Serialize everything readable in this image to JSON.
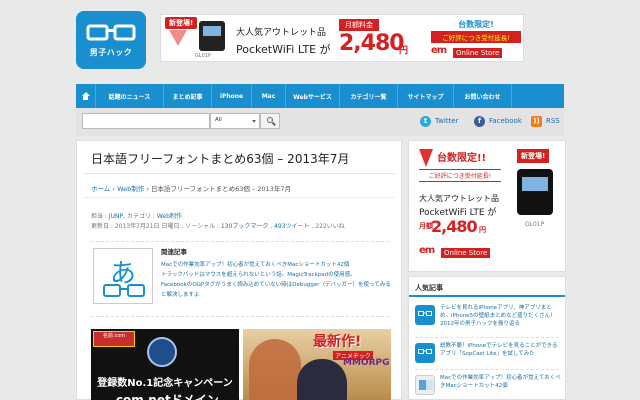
{
  "header": {
    "logo_text": "男子ハック",
    "banner": {
      "new_badge": "新登場!",
      "device_name": "GL01P",
      "line1": "大人気アウトレット品",
      "line2": "PocketWiFi LTE が",
      "fee_label": "月額料金",
      "price": "2,480",
      "yen": "円",
      "limited": "台数限定!",
      "extend": "ご好評につき受付延長!",
      "brand": "em",
      "store": "Online Store"
    }
  },
  "nav": {
    "items": [
      "話題のニュース",
      "まとめ記事",
      "iPhone",
      "Mac",
      "Webサービス",
      "カテゴリ一覧",
      "サイトマップ",
      "お問い合わせ"
    ]
  },
  "search": {
    "placeholder": "",
    "select_value": "All"
  },
  "social": {
    "twitter": "Twitter",
    "facebook": "Facebook",
    "rss": "RSS"
  },
  "article": {
    "title": "日本語フリーフォントまとめ63個 – 2013年7月",
    "breadcrumb": {
      "home": "ホーム",
      "sep": "›",
      "category": "Web制作",
      "current": "日本語フリーフォントまとめ63個 – 2013年7月"
    },
    "meta1": {
      "author_label": "担当 :",
      "author": "JUNP",
      "cat_label": ", カテゴリ :",
      "category": "Web制作"
    },
    "meta2": {
      "updated": "更新日 : 2013年7月21日 日曜日 , ソーシャル :",
      "bookmarks": "130ブックマーク",
      "tweets": "493ツイート",
      "likes": ", 222いいね"
    },
    "related": {
      "heading": "関連記事",
      "icon_char": "あ",
      "items": [
        "Macでの作業効率アップ！初心者が覚えておくべきMacショートカット42個",
        "トラックパッドはマウスを超えられないという話。MagicTrackpadの使用感。",
        "FacebookのOGPタグがうまく読み込めていない時はDebugger（デバッガー）を使ってみると解決しますよ"
      ]
    },
    "ads": {
      "left_badge": "名前.com",
      "left_line1": "登録数No.1記念キャンペーン",
      "left_line2": ".com.netドメイン",
      "right_new": "最新作!",
      "right_sub": "アニメチック",
      "right_genre": "MMORPG"
    }
  },
  "sidebar": {
    "ad": {
      "limited": "台数限定!!",
      "extend": "ご好評につき受付延長!",
      "new_badge": "新登場!",
      "line1": "大人気アウトレット品",
      "line2": "PocketWiFi LTE が",
      "monthly": "月額",
      "price": "2,480",
      "yen": "円",
      "brand": "em",
      "store": "Online Store",
      "device_name": "GL01P"
    },
    "popular": {
      "heading": "人気記事",
      "items": [
        "テレビを見れるiPhoneアプリ、神アプリまとめ。iPhone5の壁紙まとめなど盛りだくさん！2012年の男子ハックを振り返る",
        "説教不要！iPhoneでテレビを見ることができるアプリ「SopCast Lite」を試してみた",
        "Macでの作業効率アップ！初心者が覚えておくべきMacショートカット42個"
      ]
    }
  },
  "colors": {
    "brand_blue": "#1a8fd0",
    "accent_red": "#d52020",
    "link": "#1a6fa8"
  }
}
